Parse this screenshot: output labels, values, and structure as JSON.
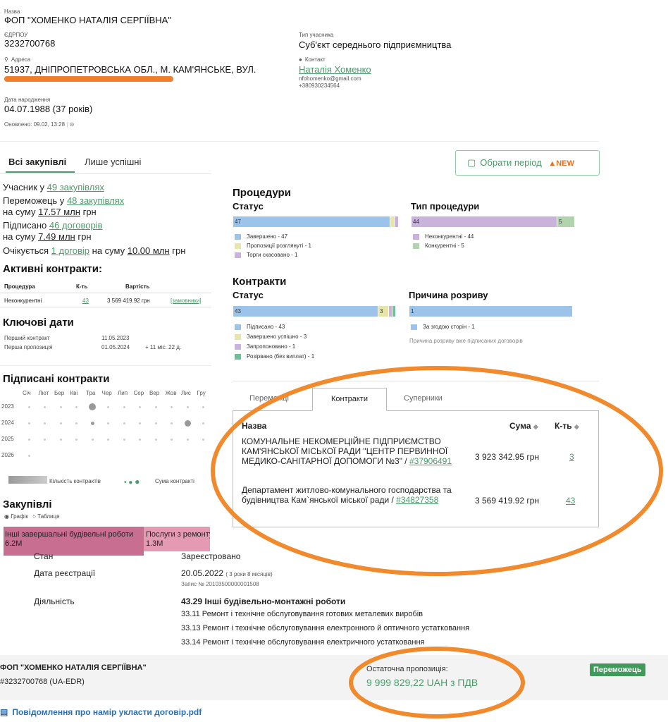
{
  "company": {
    "name_label": "Назва",
    "name": "ФОП \"ХОМЕНКО НАТАЛІЯ СЕРГІЇВНА\"",
    "edrpou_label": "ЄДРПОУ",
    "edrpou": "3232700768",
    "type_label": "Тип учасника",
    "type": "Суб'єкт середнього підприємництва",
    "address_label": "Адреса",
    "address": "51937, ДНІПРОПЕТРОВСЬКА ОБЛ., М. КАМ'ЯНСЬКЕ, ВУЛ.",
    "contact_label": "Контакт",
    "contact_name": "Наталія Хоменко",
    "contact_email": "nfohomenko@gmail.com",
    "contact_phone": "+380930234564",
    "birth_label": "Дата народження",
    "birth": "04.07.1988 (37 років)",
    "updated": "Оновлено: 09.02, 13:28"
  },
  "tabs": {
    "all": "Всі закупівлі",
    "success": "Лише успішні",
    "period_btn": "Обрати період",
    "new_badge": "NEW"
  },
  "stats": {
    "participant_pre": "Учасник у",
    "participant_link": "49 закупівлях",
    "winner_pre": "Переможець у",
    "winner_link": "48 закупівлях",
    "winner_sum_pre": "на суму",
    "winner_sum": "17.57 млн",
    "winner_cur": "грн",
    "signed_pre": "Підписано",
    "signed_link": "46 договорів",
    "signed_sum_pre": "на суму",
    "signed_sum": "7.49 млн",
    "signed_cur": "грн",
    "expected_pre": "Очікується",
    "expected_link": "1 договір",
    "expected_mid": "на суму",
    "expected_sum": "10.00 млн",
    "expected_cur": "грн"
  },
  "active": {
    "title": "Активні контракти:",
    "h_proc": "Процедура",
    "h_count": "К-ть",
    "h_value": "Вартість",
    "row_proc": "Неконкурентні",
    "row_count": "43",
    "row_value": "3 569 419.92 грн",
    "row_link": "[замовники]"
  },
  "keydates": {
    "title": "Ключові дати",
    "first_contract_label": "Перший контракт",
    "first_contract": "11.05.2023",
    "first_offer_label": "Перша пропозиція",
    "first_offer": "01.05.2024",
    "first_offer_extra": "+ 11 міс. 22 д."
  },
  "signed": {
    "title": "Підписані контракти",
    "months": [
      "Січ",
      "Лют",
      "Бер",
      "Кві",
      "Тра",
      "Чер",
      "Лип",
      "Сер",
      "Вер",
      "Жов",
      "Лис",
      "Гру"
    ],
    "years": [
      "2023",
      "2024",
      "2025",
      "2026"
    ],
    "legend_count": "Кількість контрактів",
    "legend_sum": "Сума контракті"
  },
  "procurements": {
    "title": "Закупівлі",
    "radio_graph": "Графік",
    "radio_table": "Таблиця",
    "block1": "Інші завершальні будівельні роботи",
    "block1_val": "6.2M",
    "block2": "Послуги з ремонту",
    "block2_val": "1.3M"
  },
  "procedures": {
    "title": "Процедури",
    "status_title": "Статус",
    "status_legend": [
      "Завершено - 47",
      "Пропозиції розглянуті - 1",
      "Торги скасовано - 1"
    ],
    "status_bar_label": "47",
    "type_title": "Тип процедури",
    "type_legend": [
      "Неконкурентні - 44",
      "Конкурентні - 5"
    ],
    "type_bar_a": "44",
    "type_bar_b": "5"
  },
  "contracts": {
    "title": "Контракти",
    "status_title": "Статус",
    "status_legend": [
      "Підписано - 43",
      "Завершено успішно - 3",
      "Запропоновано - 1",
      "Розірвано (без виплат) - 1"
    ],
    "status_bar_a": "43",
    "status_bar_b": "3",
    "reason_title": "Причина розриву",
    "reason_legend": [
      "За згодою сторін - 1"
    ],
    "reason_bar": "1",
    "reason_note": "Причина розриву вже підписаних договорів"
  },
  "ctabs": {
    "t1": "Переможці",
    "t2": "Контракти",
    "t3": "Суперники"
  },
  "ctable": {
    "h_name": "Назва",
    "h_sum": "Сума",
    "h_count": "К-ть",
    "rows": [
      {
        "name": "КОМУНАЛЬНЕ НЕКОМЕРЦІЙНЕ ПІДПРИЄМСТВО КАМ'ЯНСЬКОЇ МІСЬКОЇ РАДИ \"ЦЕНТР ПЕРВИННОЇ МЕДИКО-САНІТАРНОЇ ДОПОМОГИ №3\" / ",
        "code": "#37906491",
        "sum": "3 923 342.95 грн",
        "count": "3"
      },
      {
        "name": "Департамент житлово-комунального господарства та будівництва Кам`янської міської ради / ",
        "code": "#34827358",
        "sum": "3 569 419.92 грн",
        "count": "43"
      }
    ]
  },
  "registry": {
    "state_label": "Стан",
    "state": "Зареєстровано",
    "reg_label": "Дата реєстрації",
    "reg": "20.05.2022",
    "reg_extra": "( 3 роки 8 місяців)",
    "reg_no": "Запис № 20103500000001508",
    "act_label": "Діяльність",
    "act_main": "43.29 Інші будівельно-монтажні роботи",
    "act_list": [
      "33.11 Ремонт і технічне обслуговування готових металевих виробів",
      "33.13 Ремонт і технічне обслуговування електронного й оптичного устатковання",
      "33.14 Ремонт і технічне обслуговування електричного устатковання"
    ]
  },
  "bottom": {
    "name": "ФОП \"ХОМЕНКО НАТАЛІЯ СЕРГІЇВНА\"",
    "id": "#3232700768 (UA-EDR)",
    "offer_label": "Остаточна пропозиція:",
    "offer": "9 999 829,22 UAH з ПДВ",
    "winner_badge": "Переможець",
    "pdf": "Повідомлення про намір укласти договір.pdf"
  },
  "colors": {
    "green": "#4a9a6a",
    "blue": "#9cc3ea",
    "purple": "#c9b3dd",
    "lightgreen": "#afd4ae",
    "orange": "#f08a2c"
  }
}
